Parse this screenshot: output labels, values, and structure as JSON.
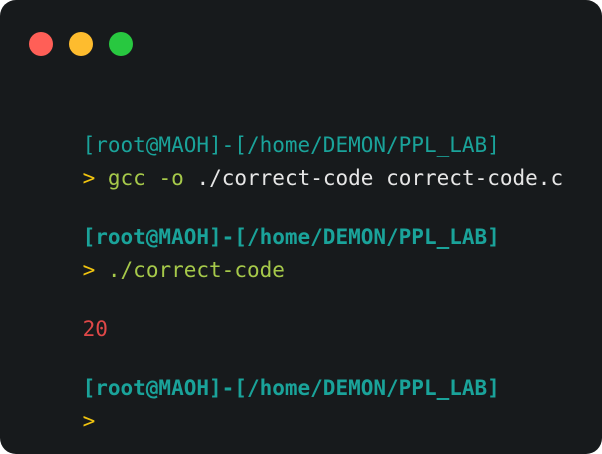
{
  "window": {
    "controls": [
      "close",
      "minimize",
      "maximize"
    ]
  },
  "session": [
    {
      "prompt": "[root@MAOH]-[/home/DEMON/PPL_LAB]",
      "arrow": ">",
      "command": "gcc",
      "flag": "-o",
      "args": "./correct-code correct-code.c"
    },
    {
      "prompt": "[root@MAOH]-[/home/DEMON/PPL_LAB]",
      "arrow": ">",
      "command": "./correct-code"
    },
    {
      "output": "20"
    },
    {
      "prompt": "[root@MAOH]-[/home/DEMON/PPL_LAB]",
      "arrow": ">"
    }
  ],
  "colors": {
    "background": "#171a1c",
    "prompt": "#1aa39a",
    "arrow": "#f1c40f",
    "command": "#a6c94a",
    "args": "#e6e6e6",
    "output": "#e04848"
  }
}
